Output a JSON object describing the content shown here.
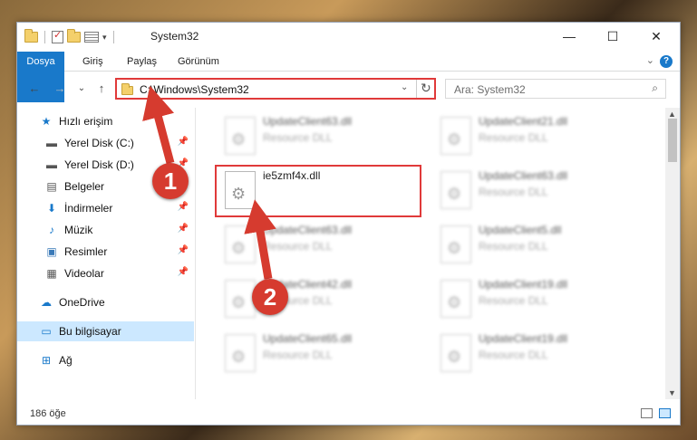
{
  "window": {
    "title": "System32",
    "controls": {
      "minimize": "—",
      "maximize": "☐",
      "close": "✕"
    }
  },
  "ribbon": {
    "tabs": [
      "Dosya",
      "Giriş",
      "Paylaş",
      "Görünüm"
    ],
    "help": "?"
  },
  "navbar": {
    "back": "←",
    "forward": "→",
    "recent": "⌄",
    "up": "↑",
    "address": "C:\\Windows\\System32",
    "search_placeholder": "Ara: System32"
  },
  "sidebar": {
    "items": [
      {
        "label": "Hızlı erişim",
        "icon": "star-icon"
      },
      {
        "label": "Yerel Disk (C:)",
        "icon": "drive-icon",
        "pinned": true
      },
      {
        "label": "Yerel Disk (D:)",
        "icon": "drive-icon",
        "pinned": true
      },
      {
        "label": "Belgeler",
        "icon": "documents-icon",
        "pinned": true
      },
      {
        "label": "İndirmeler",
        "icon": "download-icon",
        "pinned": true
      },
      {
        "label": "Müzik",
        "icon": "music-icon",
        "pinned": true
      },
      {
        "label": "Resimler",
        "icon": "pictures-icon",
        "pinned": true
      },
      {
        "label": "Videolar",
        "icon": "video-icon",
        "pinned": true
      },
      {
        "label": "OneDrive",
        "icon": "cloud-icon"
      },
      {
        "label": "Bu bilgisayar",
        "icon": "computer-icon",
        "selected": true
      },
      {
        "label": "Ağ",
        "icon": "network-icon"
      }
    ]
  },
  "files": {
    "left": [
      {
        "name": "UpdateClient63.dll",
        "desc": "Resource DLL"
      },
      {
        "name": "ie5zmf4x.dll",
        "desc": ""
      },
      {
        "name": "UpdateClient63.dll",
        "desc": "Resource DLL"
      },
      {
        "name": "UpdateClient42.dll",
        "desc": "Resource DLL"
      },
      {
        "name": "UpdateClient65.dll",
        "desc": "Resource DLL"
      }
    ],
    "right": [
      {
        "name": "UpdateClient21.dll",
        "desc": "Resource DLL"
      },
      {
        "name": "UpdateClient63.dll",
        "desc": "Resource DLL"
      },
      {
        "name": "UpdateClient5.dll",
        "desc": "Resource DLL"
      },
      {
        "name": "UpdateClient19.dll",
        "desc": "Resource DLL"
      },
      {
        "name": "UpdateClient19.dll",
        "desc": "Resource DLL"
      }
    ]
  },
  "status": {
    "count": "186 öğe"
  },
  "annotations": {
    "marker1": "1",
    "marker2": "2",
    "color": "#d63b2f"
  },
  "colors": {
    "accent": "#1979ca",
    "highlight": "#e03a3a",
    "selection": "#cce8ff"
  }
}
